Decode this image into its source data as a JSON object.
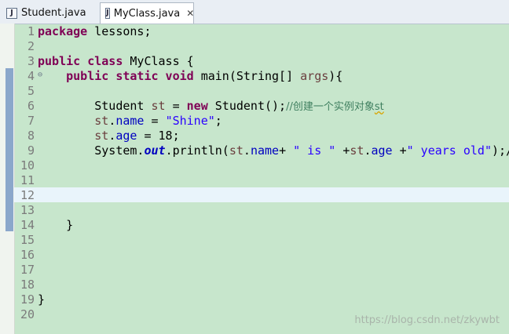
{
  "tabs": [
    {
      "label": "Student.java",
      "active": false
    },
    {
      "label": "MyClass.java",
      "active": true,
      "close_glyph": "✕"
    }
  ],
  "code_lines": [
    "package lessons;",
    "",
    "public class MyClass {",
    "    public static void main(String[] args){",
    "",
    "        Student st = new Student();//创建一个实例对象st",
    "        st.name = \"Shine\";",
    "        st.age = 18;",
    "        System.out.println(st.name+ \" is \" +st.age +\" years old\");/",
    "",
    "",
    "",
    "",
    "    }",
    "",
    "",
    "",
    "",
    "}",
    ""
  ],
  "line_numbers": [
    "1",
    "2",
    "3",
    "4",
    "5",
    "6",
    "7",
    "8",
    "9",
    "10",
    "11",
    "12",
    "13",
    "14",
    "15",
    "16",
    "17",
    "18",
    "19",
    "20"
  ],
  "current_line": 12,
  "watermark": "https://blog.csdn.net/zkywbt",
  "colors": {
    "editor_bg": "#c7e6cc",
    "keyword": "#7f0055",
    "string": "#2a00ff",
    "field": "#0000c0",
    "comment": "#3f7f5f",
    "current_line": "#e9f4fb"
  },
  "icons": {
    "java_file": "java-file-icon",
    "close": "close-icon",
    "fold": "fold-minus-icon"
  }
}
